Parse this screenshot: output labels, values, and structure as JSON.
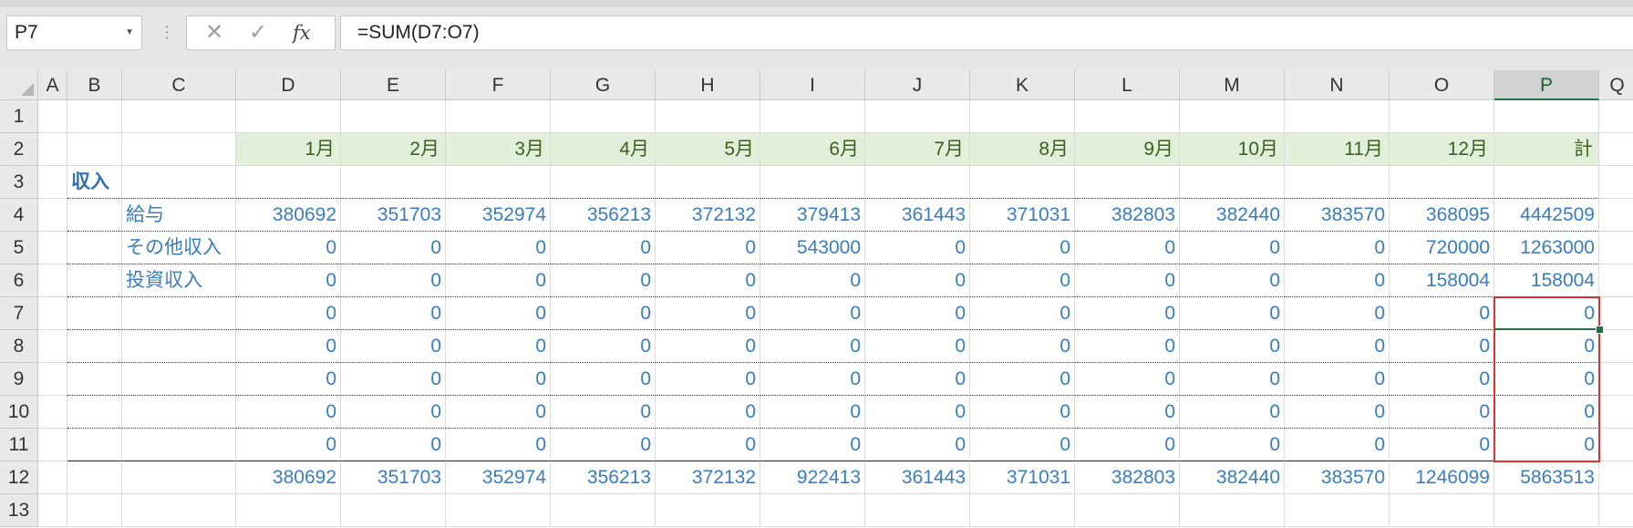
{
  "formula_bar": {
    "name_box": "P7",
    "formula": "=SUM(D7:O7)",
    "cancel_icon": "✕",
    "enter_icon": "✓",
    "fx_label": "fx"
  },
  "columns": [
    "A",
    "B",
    "C",
    "D",
    "E",
    "F",
    "G",
    "H",
    "I",
    "J",
    "K",
    "L",
    "M",
    "N",
    "O",
    "P",
    "Q"
  ],
  "rows": [
    "1",
    "2",
    "3",
    "4",
    "5",
    "6",
    "7",
    "8",
    "9",
    "10",
    "11",
    "12",
    "13"
  ],
  "selected_cell": "P7",
  "months": [
    "1月",
    "2月",
    "3月",
    "4月",
    "5月",
    "6月",
    "7月",
    "8月",
    "9月",
    "10月",
    "11月",
    "12月",
    "計"
  ],
  "section_label": "収入",
  "line_items": [
    {
      "label": "給与",
      "values": [
        "380692",
        "351703",
        "352974",
        "356213",
        "372132",
        "379413",
        "361443",
        "371031",
        "382803",
        "382440",
        "383570",
        "368095",
        "4442509"
      ]
    },
    {
      "label": "その他収入",
      "values": [
        "0",
        "0",
        "0",
        "0",
        "0",
        "543000",
        "0",
        "0",
        "0",
        "0",
        "0",
        "720000",
        "1263000"
      ]
    },
    {
      "label": "投資収入",
      "values": [
        "0",
        "0",
        "0",
        "0",
        "0",
        "0",
        "0",
        "0",
        "0",
        "0",
        "0",
        "158004",
        "158004"
      ]
    },
    {
      "label": "",
      "values": [
        "0",
        "0",
        "0",
        "0",
        "0",
        "0",
        "0",
        "0",
        "0",
        "0",
        "0",
        "0",
        "0"
      ]
    },
    {
      "label": "",
      "values": [
        "0",
        "0",
        "0",
        "0",
        "0",
        "0",
        "0",
        "0",
        "0",
        "0",
        "0",
        "0",
        "0"
      ]
    },
    {
      "label": "",
      "values": [
        "0",
        "0",
        "0",
        "0",
        "0",
        "0",
        "0",
        "0",
        "0",
        "0",
        "0",
        "0",
        "0"
      ]
    },
    {
      "label": "",
      "values": [
        "0",
        "0",
        "0",
        "0",
        "0",
        "0",
        "0",
        "0",
        "0",
        "0",
        "0",
        "0",
        "0"
      ]
    },
    {
      "label": "",
      "values": [
        "0",
        "0",
        "0",
        "0",
        "0",
        "0",
        "0",
        "0",
        "0",
        "0",
        "0",
        "0",
        "0"
      ]
    }
  ],
  "totals": [
    "380692",
    "351703",
    "352974",
    "356213",
    "372132",
    "922413",
    "361443",
    "371031",
    "382803",
    "382440",
    "383570",
    "1246099",
    "5863513"
  ],
  "colors": {
    "accent_green": "#217346",
    "selection_red": "#e03030",
    "value_blue": "#3a7dbf",
    "header_fill": "#e2efda"
  }
}
